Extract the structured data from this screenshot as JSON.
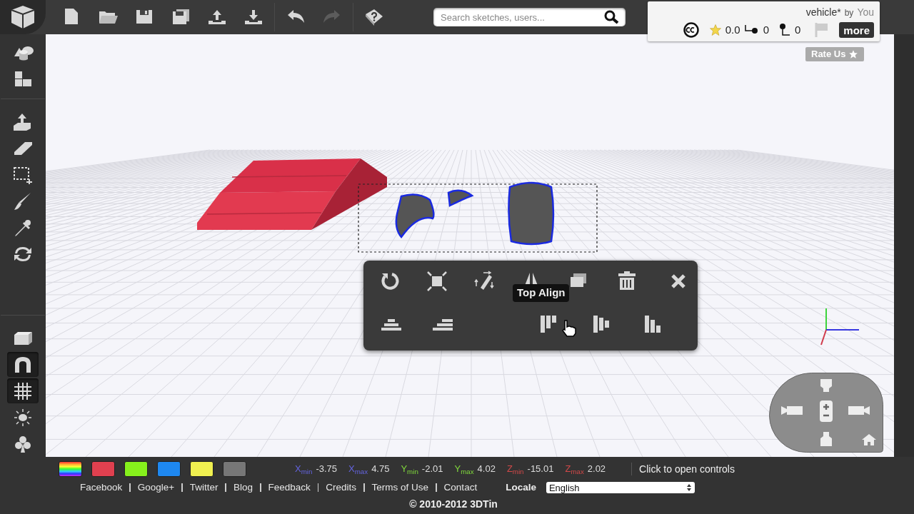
{
  "toolbar": {
    "groups": [
      [
        {
          "kind": "new",
          "disabled": false
        },
        {
          "kind": "open",
          "disabled": false
        },
        {
          "kind": "save",
          "disabled": false
        },
        {
          "kind": "save-as",
          "disabled": false
        },
        {
          "kind": "upload",
          "disabled": false
        },
        {
          "kind": "download",
          "disabled": false
        }
      ],
      [
        {
          "kind": "undo",
          "disabled": false
        },
        {
          "kind": "redo",
          "disabled": true
        }
      ],
      [
        {
          "kind": "help",
          "disabled": false
        }
      ]
    ]
  },
  "search": {
    "placeholder": "Search sketches, users..."
  },
  "sketch": {
    "name": "vehicle*",
    "by": "by",
    "author": "You",
    "rating": "0.0",
    "forks": "0",
    "remixes": "0",
    "more": "more"
  },
  "rate_us": "Rate Us",
  "sidebar": {
    "groups": [
      [
        {
          "kind": "primitives",
          "on": false
        },
        {
          "kind": "blocks",
          "on": false
        }
      ],
      [
        {
          "kind": "extrude",
          "on": false
        },
        {
          "kind": "eraser",
          "on": false
        },
        {
          "kind": "select",
          "on": false
        },
        {
          "kind": "brush",
          "on": false
        },
        {
          "kind": "dropper",
          "on": false
        },
        {
          "kind": "rotate",
          "on": false
        }
      ],
      [
        {
          "kind": "box",
          "on": false
        },
        {
          "kind": "magnet",
          "on": true
        },
        {
          "kind": "grid",
          "on": true
        },
        {
          "kind": "light",
          "on": false
        },
        {
          "kind": "club",
          "on": false
        }
      ]
    ]
  },
  "selection_toolbar": {
    "rows": [
      [
        {
          "kind": "reset"
        },
        {
          "kind": "fit"
        },
        {
          "kind": "flip"
        },
        {
          "kind": "mirror"
        },
        {
          "kind": "duplicate"
        },
        {
          "kind": "delete"
        },
        {
          "kind": "close"
        }
      ],
      [
        {
          "kind": "stack-center"
        },
        {
          "kind": "stack-right"
        },
        {
          "kind": "top-align"
        },
        {
          "kind": "center-align"
        },
        {
          "kind": "bottom-align"
        }
      ]
    ],
    "tooltip": "Top Align"
  },
  "palette": [
    {
      "kind": "rainbow"
    },
    {
      "kind": "solid",
      "color": "#e0404f"
    },
    {
      "kind": "solid",
      "color": "#86f01c"
    },
    {
      "kind": "solid",
      "color": "#1e88f0"
    },
    {
      "kind": "solid",
      "color": "#f0f050"
    },
    {
      "kind": "solid",
      "color": "#777777"
    }
  ],
  "bounds": [
    {
      "label": "X$_{min}$",
      "value": "-3.75",
      "color": "#6464e0"
    },
    {
      "label": "X$_{max}$",
      "value": "4.75",
      "color": "#6464e0"
    },
    {
      "label": "Y$_{min}$",
      "value": "-2.01",
      "color": "#7fd63c"
    },
    {
      "label": "Y$_{max}$",
      "value": "4.02",
      "color": "#7fd63c"
    },
    {
      "label": "Z$_{min}$",
      "value": "-15.01",
      "color": "#d04848"
    },
    {
      "label": "Z$_{max}$",
      "value": "2.02",
      "color": "#d04848"
    }
  ],
  "controls_link": "Click to open controls",
  "links": [
    "Facebook",
    "Google+",
    "Twitter",
    "Blog",
    "Feedback",
    "Credits",
    "Terms of Use",
    "Contact"
  ],
  "locale": {
    "label": "Locale",
    "value": "English"
  },
  "copyright": "© 2010-2012 3DTin"
}
